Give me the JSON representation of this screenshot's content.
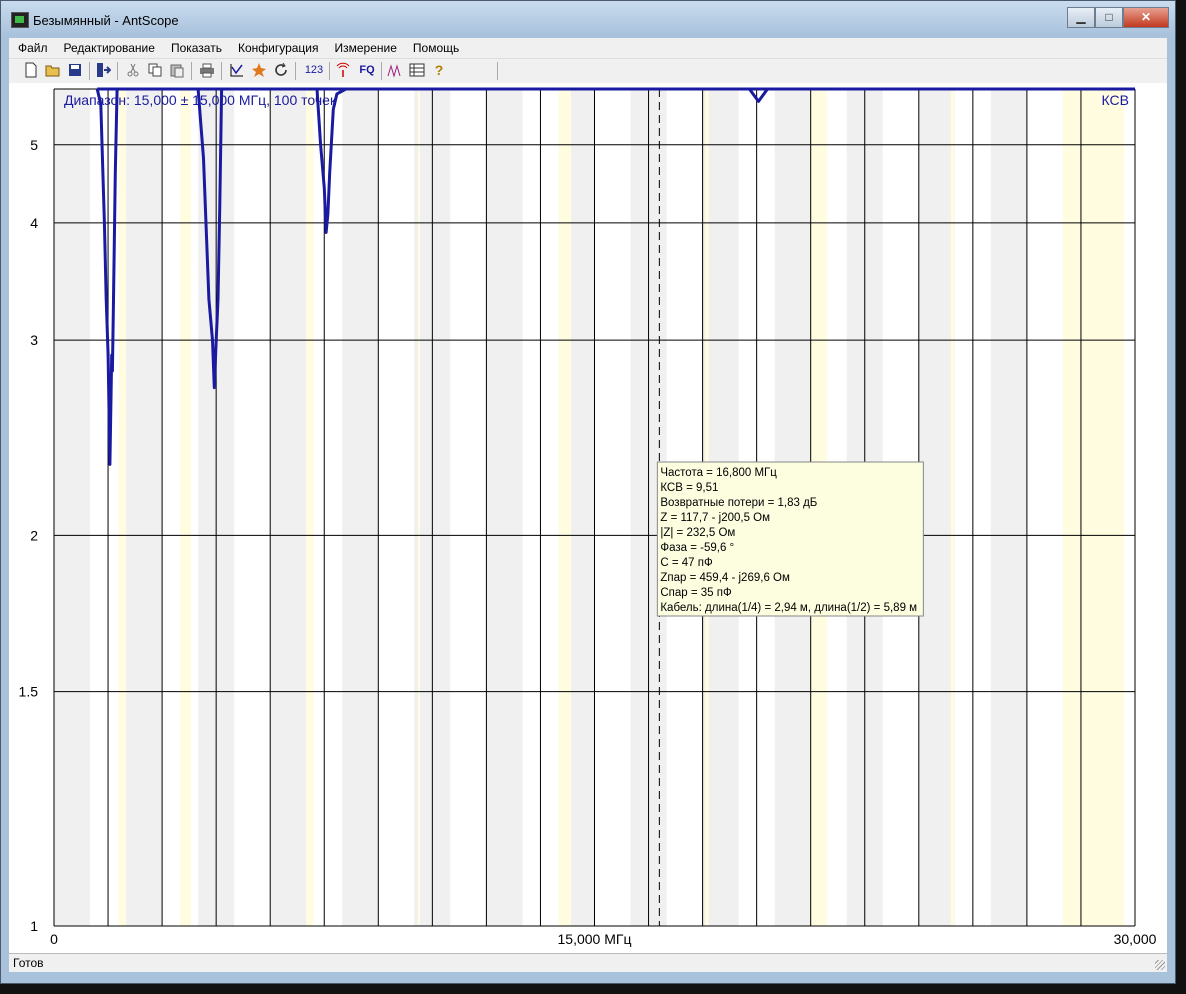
{
  "window": {
    "title": "Безымянный - AntScope",
    "minimize": "▁",
    "maximize": "□",
    "close": "✕"
  },
  "menu": [
    "Файл",
    "Редактирование",
    "Показать",
    "Конфигурация",
    "Измерение",
    "Помощь"
  ],
  "toolbar_icons": [
    "new-icon",
    "open-icon",
    "save-icon",
    "export-icon",
    "cut-icon",
    "copy-icon",
    "paste-icon",
    "print-icon",
    "graph-icon",
    "scan-icon",
    "refresh-icon",
    "numbers-icon",
    "antenna-icon",
    "fq-icon",
    "markers-icon",
    "table-icon",
    "help-icon"
  ],
  "toolbar_labels": {
    "numbers": "123",
    "fq": "FQ",
    "help": "?"
  },
  "status": "Готов",
  "chart_data": {
    "type": "line",
    "range_label": "Диапазон: 15,000 ± 15,000 МГц, 100 точек",
    "series_label": "КСВ",
    "xlim": [
      0,
      30
    ],
    "ylim": [
      1,
      6
    ],
    "y_scale": "swr",
    "x_ticks": [
      {
        "v": 0,
        "label": "0"
      },
      {
        "v": 15,
        "label": "15,000 МГц"
      },
      {
        "v": 30,
        "label": "30,000"
      }
    ],
    "y_ticks": [
      {
        "v": 1,
        "label": "1"
      },
      {
        "v": 1.5,
        "label": "1.5"
      },
      {
        "v": 2,
        "label": "2"
      },
      {
        "v": 3,
        "label": "3"
      },
      {
        "v": 4,
        "label": "4"
      },
      {
        "v": 5,
        "label": "5"
      }
    ],
    "grid": true,
    "band_highlights": [
      [
        1.8,
        2.0
      ],
      [
        3.5,
        3.8
      ],
      [
        7.0,
        7.2
      ],
      [
        10.1,
        10.15
      ],
      [
        14.0,
        14.35
      ],
      [
        18.07,
        18.17
      ],
      [
        21.0,
        21.45
      ],
      [
        24.89,
        24.99
      ],
      [
        28.0,
        29.7
      ]
    ],
    "cursor_x": 16.8,
    "series": [
      {
        "x": [
          1.2,
          1.3,
          1.4,
          1.45,
          1.5,
          1.55,
          1.6,
          1.62,
          1.65,
          1.7,
          1.75,
          1.85,
          4.0,
          4.15,
          4.3,
          4.4,
          4.45,
          4.5,
          4.55,
          4.6,
          4.65,
          4.8,
          4.95,
          7.3,
          7.4,
          7.5,
          7.55,
          7.6,
          7.65,
          7.75,
          7.85,
          8.1,
          19.3,
          19.55,
          19.8
        ],
        "y": [
          6,
          5.7,
          4.0,
          3.3,
          2.9,
          2.3,
          2.9,
          2.8,
          3.3,
          4.6,
          6,
          6,
          6,
          4.8,
          3.3,
          3.0,
          2.7,
          3.0,
          3.3,
          4.2,
          6,
          6,
          6,
          6,
          5.0,
          4.4,
          3.9,
          4.1,
          4.6,
          5.6,
          5.9,
          6,
          6,
          5.75,
          6
        ]
      }
    ],
    "tooltip": [
      "Частота = 16,800 МГц",
      "КСВ = 9,51",
      "Возвратные потери = 1,83 дБ",
      "Z = 117,7 - j200,5 Ом",
      "|Z| = 232,5 Ом",
      "Фаза = -59,6 °",
      "C = 47 пФ",
      "Zпар = 459,4 - j269,6 Ом",
      "Cпар = 35 пФ",
      "Кабель: длина(1/4) = 2,94 м, длина(1/2) = 5,89 м"
    ],
    "colors": {
      "line": "#1a1aa0",
      "band": "#fffce0",
      "plot_bg": "#f0f0f0",
      "tooltip_bg": "#fdfde0"
    }
  }
}
